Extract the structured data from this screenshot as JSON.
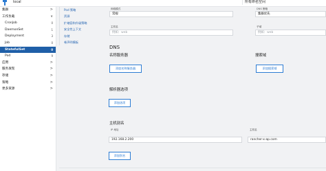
{
  "topbar": {
    "cluster_name": "local",
    "namespace_select": "所有命名空间"
  },
  "sidebar": {
    "items": [
      {
        "label": "集群",
        "type": "group",
        "marker": ">"
      },
      {
        "label": "工作负载",
        "type": "group",
        "marker": "∨"
      },
      {
        "label": "CronJob",
        "type": "sub",
        "count": "0"
      },
      {
        "label": "DaemonSet",
        "type": "sub",
        "count": "1"
      },
      {
        "label": "Deployment",
        "type": "sub",
        "count": "3"
      },
      {
        "label": "Job",
        "type": "sub",
        "count": "0"
      },
      {
        "label": "StatefulSet",
        "type": "sub",
        "count": "0",
        "active": true
      },
      {
        "label": "Pod",
        "type": "sub",
        "count": "9"
      },
      {
        "label": "应用",
        "type": "group",
        "marker": ">"
      },
      {
        "label": "服务发现",
        "type": "group",
        "marker": ">"
      },
      {
        "label": "存储",
        "type": "group",
        "marker": ">"
      },
      {
        "label": "策略",
        "type": "group",
        "marker": ">"
      },
      {
        "label": "更多资源",
        "type": "group",
        "marker": ">"
      }
    ]
  },
  "tabs": [
    "Pod 策略",
    "资源",
    "扩缩容和升级策略",
    "安全性上下文",
    "存储",
    "卷声明模板"
  ],
  "form": {
    "network_mode": {
      "label": "网络模式",
      "value": "常规"
    },
    "dns_policy": {
      "label": "DNS 策略",
      "value": "集群优先"
    },
    "hostname": {
      "label": "主机名",
      "placeholder": "例如：web"
    },
    "subdomain": {
      "label": "子域",
      "placeholder": "例如：web"
    },
    "dns_title": "DNS",
    "nameservers_title": "名称服务器",
    "add_nameserver_button": "添加名称服务器",
    "search_domains_title": "搜索域",
    "add_search_domain_button": "添加搜索域",
    "resolver_title": "解析器选项",
    "add_option_button": "添加选项",
    "host_alias_title": "主机别名",
    "ip_label": "IP 地址",
    "hostname_label": "主机名",
    "alias_ip": "192.168.2.200",
    "alias_hostname": "rancher-x-ap.com",
    "add_alias_button": "添加别名"
  }
}
